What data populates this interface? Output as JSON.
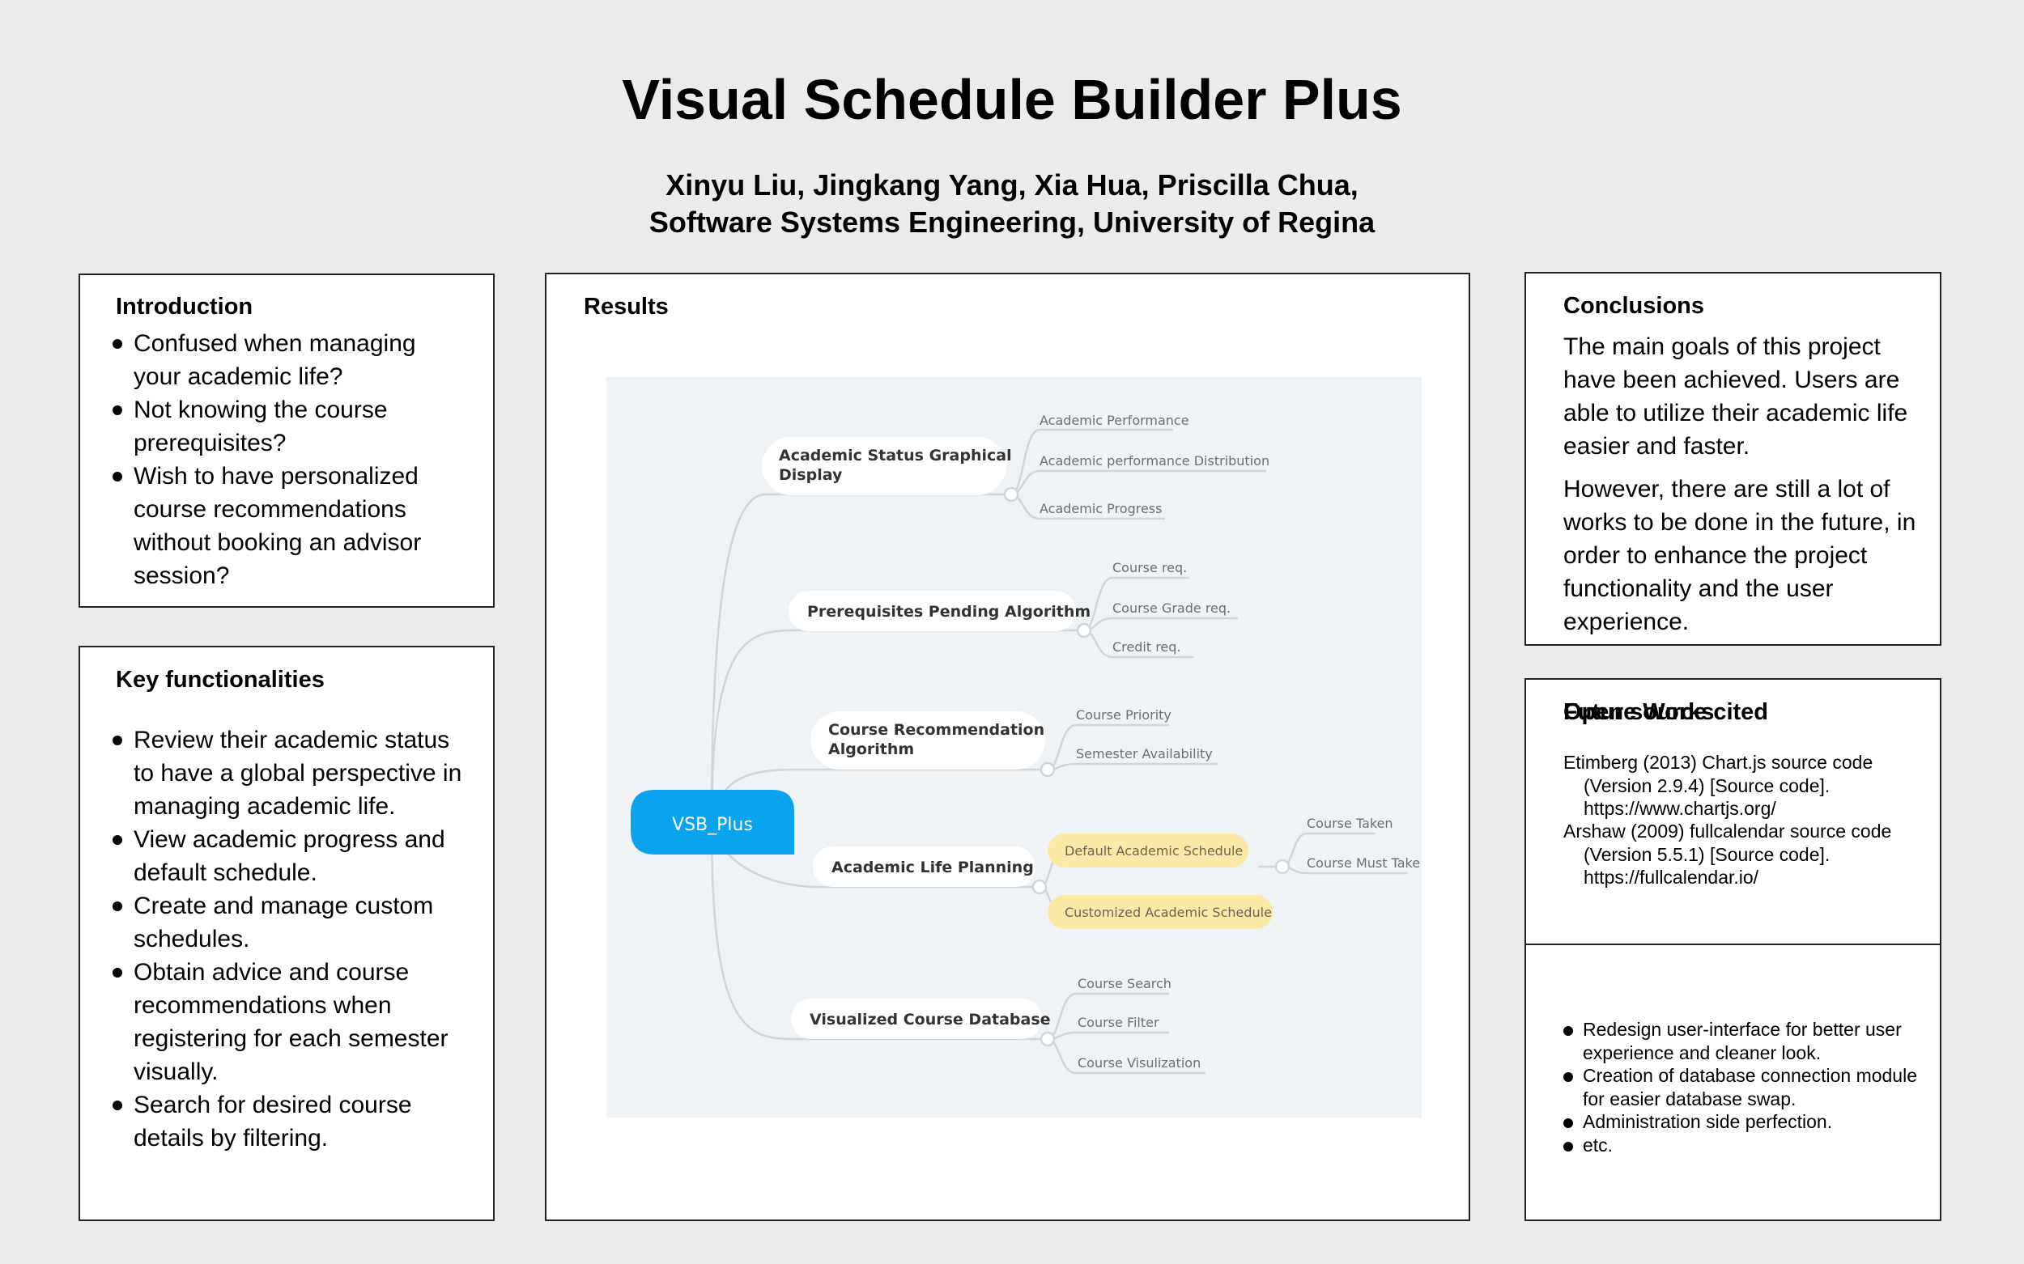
{
  "title": "Visual Schedule Builder Plus",
  "authors_line1": "Xinyu Liu, Jingkang Yang, Xia Hua, Priscilla Chua,",
  "authors_line2": "Software Systems Engineering, University of Regina",
  "introduction": {
    "heading": "Introduction",
    "items": [
      "Confused when managing your academic life?",
      "Not knowing the course prerequisites?",
      "Wish to have personalized course recommendations without booking an advisor session?"
    ]
  },
  "key_functionalities": {
    "heading": "Key functionalities",
    "items": [
      "Review their academic status to have a global perspective in managing academic life.",
      "View academic progress and default schedule.",
      "Create and manage custom schedules.",
      "Obtain advice and course recommendations when registering for each semester visually.",
      "Search for desired course details by filtering."
    ]
  },
  "results": {
    "heading": "Results",
    "mindmap": {
      "root": "VSB_Plus",
      "branches": [
        {
          "line1": "Academic Status Graphical",
          "line2": "Display",
          "leaves": [
            "Academic Performance",
            "Academic performance Distribution",
            "Academic Progress"
          ]
        },
        {
          "line1": "Prerequisites Pending Algorithm",
          "line2": "",
          "leaves": [
            "Course req.",
            "Course Grade req.",
            "Credit req."
          ]
        },
        {
          "line1": "Course Recommendation",
          "line2": "Algorithm",
          "leaves": [
            "Course Priority",
            "Semester Availability"
          ]
        },
        {
          "line1": "Academic Life Planning",
          "line2": "",
          "subnodes": [
            {
              "label": "Default Academic Schedule",
              "leaves": [
                "Course Taken",
                "Course Must Take"
              ]
            },
            {
              "label": "Customized Academic Schedule",
              "leaves": []
            }
          ]
        },
        {
          "line1": "Visualized Course Database",
          "line2": "",
          "leaves": [
            "Course Search",
            "Course Filter",
            "Course Visulization"
          ]
        }
      ]
    }
  },
  "conclusions": {
    "heading": "Conclusions",
    "paragraph1": "The main goals of this project have been achieved. Users are able to utilize their academic life easier and faster.",
    "paragraph2": "However, there are still a lot of works to be done in the future, in order to enhance the project functionality and the user experience."
  },
  "open_source": {
    "heading": "Open source cited",
    "citations": [
      {
        "line1": "Etimberg (2013) Chart.js source code",
        "line2": "(Version 2.9.4) [Source code].",
        "line3": "https://www.chartjs.org/"
      },
      {
        "line1": "Arshaw (2009) fullcalendar source code",
        "line2": "(Version 5.5.1) [Source code].",
        "line3": "https://fullcalendar.io/"
      }
    ]
  },
  "future_works": {
    "heading": "Future Works",
    "items": [
      "Redesign user-interface for better user experience and cleaner look.",
      "Creation of database connection module for easier database swap.",
      "Administration side perfection.",
      "etc."
    ]
  },
  "colors": {
    "root_node": "#0aa3ee",
    "highlight_node": "#fde9a6",
    "mindmap_bg": "#eff3f5",
    "connector": "#cfd6db"
  }
}
